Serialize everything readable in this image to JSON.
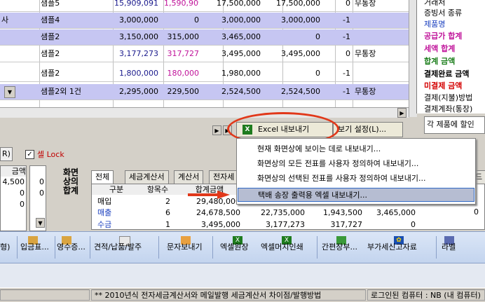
{
  "grid": {
    "rows": [
      {
        "col0": "",
        "name": "샘플5",
        "a": "15,909,091",
        "b": "1,590,909",
        "c": "17,500,000",
        "d": "17,500,000",
        "e": "0",
        "f": "무통장",
        "selected": false
      },
      {
        "col0": "사",
        "name": "샘플4",
        "a": "3,000,000",
        "b": "0",
        "c": "3,000,000",
        "d": "3,000,000",
        "e": "-1",
        "f": "",
        "selected": true
      },
      {
        "col0": "",
        "name": "샘플2",
        "a": "3,150,000",
        "b": "315,000",
        "c": "3,465,000",
        "d": "0",
        "e": "-1",
        "f": "",
        "selected": true
      },
      {
        "col0": "",
        "name": "샘플2",
        "a": "3,177,273",
        "b": "317,727",
        "c": "3,495,000",
        "d": "3,495,000",
        "e": "0",
        "f": "무통장",
        "selected": false
      },
      {
        "col0": "",
        "name": "샘플2",
        "a": "1,800,000",
        "b": "180,000",
        "c": "1,980,000",
        "d": "0",
        "e": "-1",
        "f": "",
        "selected": false
      },
      {
        "col0": "",
        "name": "샘플2외 1건",
        "a": "2,295,000",
        "b": "229,500",
        "c": "2,524,500",
        "d": "2,524,500",
        "e": "-1",
        "f": "무통장",
        "selected": true
      }
    ],
    "dropdown_glyph": "▼",
    "magenta": "#c0139a"
  },
  "right_panel": {
    "items": [
      {
        "text": "거래처",
        "color": "#000000",
        "bold": false
      },
      {
        "text": "증빙서 종류",
        "color": "#000000",
        "bold": false
      },
      {
        "text": "제품명",
        "color": "#000000",
        "bold": false
      },
      {
        "text": "공급가 합계",
        "color": "#c0139a",
        "bold": true
      },
      {
        "text": "세액 합계",
        "color": "#c0139a",
        "bold": true
      },
      {
        "text": "합계 금액",
        "color": "#1a7d1a",
        "bold": true
      },
      {
        "text": "결제완료 금액",
        "color": "#000000",
        "bold": true
      },
      {
        "text": "미결제 금액",
        "color": "#d40000",
        "bold": true
      },
      {
        "text": "결제(지불)방법",
        "color": "#000000",
        "bold": false
      },
      {
        "text": "결제계좌(통장)",
        "color": "#000000",
        "bold": false
      }
    ],
    "note": "각 제품에 할인"
  },
  "excel_button": {
    "label": "Excel 내보내기",
    "icon": "excel-icon"
  },
  "view_settings": {
    "label": "보기 설정(L)..."
  },
  "options": {
    "r_button": "R)",
    "cell_lock": "셀 Lock"
  },
  "left_table": {
    "header": "금액",
    "values": [
      "4,500",
      "0",
      "0"
    ],
    "col2": [
      "0",
      "0"
    ]
  },
  "summary": {
    "title_vertical": "화면 상의 합계",
    "tabs": [
      "전체",
      "세금계산서",
      "계산서",
      "전자세"
    ],
    "right_tab": "드",
    "headers": [
      "구분",
      "항목수",
      "합계금액",
      "",
      "",
      ""
    ],
    "rows": [
      {
        "kind": "매입",
        "count": "2",
        "amount": "29,480,000",
        "d": "",
        "e": "",
        "f": ""
      },
      {
        "kind": "매출",
        "count": "6",
        "amount": "24,678,500",
        "d": "22,735,000",
        "e": "1,943,500",
        "f": "3,465,000"
      },
      {
        "kind": "수금",
        "count": "1",
        "amount": "3,495,000",
        "d": "3,177,273",
        "e": "317,727",
        "f": "0"
      }
    ],
    "trailing": "0"
  },
  "menu": {
    "items": [
      {
        "label": "현재 화면상에 보이는 데로 내보내기...",
        "highlighted": false
      },
      {
        "label": "화면상의 모든 전표를 사용자 정의하여 내보내기...",
        "highlighted": false
      },
      {
        "label": "화면상의 선택된 전표를 사용자 정의하여 내보내기...",
        "highlighted": false
      },
      {
        "label": "택배 송장 출력용 엑셀 내보내기...",
        "highlighted": true
      }
    ]
  },
  "toolbar": {
    "items": [
      {
        "label": "형)",
        "icon": ""
      },
      {
        "label": "입금표...",
        "icon": "receipt-icon"
      },
      {
        "label": "영수증...",
        "icon": "receipt-icon"
      },
      {
        "label": "견적/납품/발주",
        "icon": "document-icon"
      },
      {
        "label": "문자보내기",
        "icon": "phone-icon"
      },
      {
        "label": "엑셀원장",
        "icon": "excel-icon"
      },
      {
        "label": "엑셀머지인쇄",
        "icon": "excel-icon"
      },
      {
        "label": "간편장부...",
        "icon": "book-icon"
      },
      {
        "label": "부가세신고자료",
        "icon": "flower-icon"
      },
      {
        "label": "라벨",
        "icon": "label-icon"
      }
    ]
  },
  "status": {
    "left": "",
    "message": "** 2010년식 전자세금계산서와 메일발행 세금계산서 차이점/발행방법",
    "computer": "로그인된 컴퓨터 : NB (내 컴퓨터)"
  },
  "colors": {
    "accent_red": "#e1381a",
    "selection": "#c6c6f2",
    "menu_highlight": "#b6bdd2"
  }
}
